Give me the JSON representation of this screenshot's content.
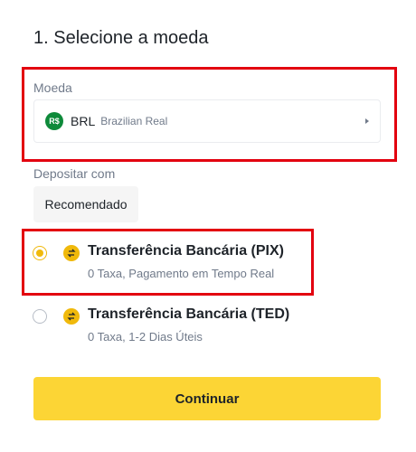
{
  "page": {
    "title": "1. Selecione a moeda"
  },
  "currency": {
    "label": "Moeda",
    "icon_text": "R$",
    "code": "BRL",
    "name": "Brazilian Real",
    "coin_color": "#0e8a3a"
  },
  "deposit": {
    "label": "Depositar com",
    "filter": "Recomendado"
  },
  "methods": [
    {
      "title": "Transferência Bancária (PIX)",
      "subtitle": "0 Taxa, Pagamento em Tempo Real",
      "selected": true
    },
    {
      "title": "Transferência Bancária (TED)",
      "subtitle": "0 Taxa, 1-2 Dias Úteis",
      "selected": false
    }
  ],
  "actions": {
    "continue_label": "Continuar"
  },
  "colors": {
    "accent": "#f0b90b",
    "button": "#fcd535",
    "highlight": "#e3000f"
  }
}
